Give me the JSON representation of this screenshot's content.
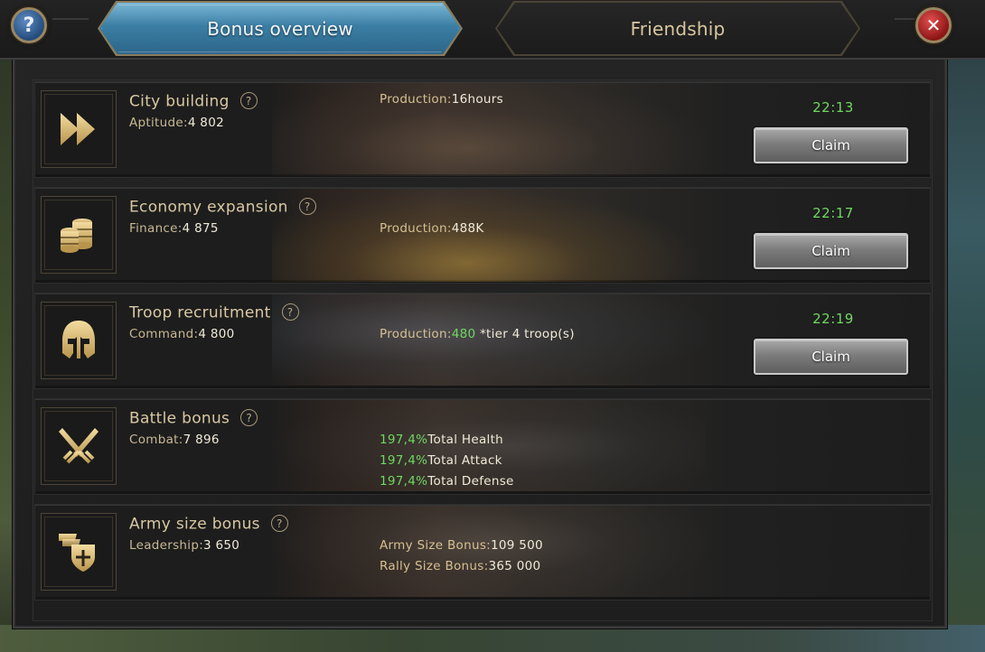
{
  "tabs": {
    "active": "Bonus overview",
    "inactive": "Friendship"
  },
  "buttons": {
    "help": "?",
    "close": "✕",
    "claim": "Claim"
  },
  "rows": [
    {
      "title": "City building",
      "stat_label": "Aptitude:",
      "stat_value": "4 802",
      "production_label": "Production:",
      "production_value": "16hours",
      "timer": "22:13",
      "icon": "fast-forward-icon"
    },
    {
      "title": "Economy expansion",
      "stat_label": "Finance:",
      "stat_value": "4 875",
      "production_label": "Production:",
      "production_value": "488K",
      "timer": "22:17",
      "icon": "coin-stack-icon"
    },
    {
      "title": "Troop recruitment",
      "stat_label": "Command:",
      "stat_value": "4 800",
      "production_label": "Production:",
      "production_value": "480",
      "production_suffix": " *tier 4 troop(s)",
      "timer": "22:19",
      "icon": "helmet-icon"
    },
    {
      "title": "Battle bonus",
      "stat_label": "Combat:",
      "stat_value": "7 896",
      "bonuses": [
        {
          "value": "197,4%",
          "label": "Total Health"
        },
        {
          "value": "197,4%",
          "label": "Total Attack"
        },
        {
          "value": "197,4%",
          "label": "Total Defense"
        }
      ],
      "icon": "crossed-swords-icon"
    },
    {
      "title": "Army size bonus",
      "stat_label": "Leadership:",
      "stat_value": "3 650",
      "army_size_label": "Army Size Bonus:",
      "army_size_value": "109 500",
      "rally_size_label": "Rally Size Bonus:",
      "rally_size_value": "365 000",
      "icon": "shield-flags-icon"
    }
  ],
  "colors": {
    "accent_tab": "#3b7ea4",
    "timer_green": "#6fd860",
    "title_gold": "#d9c8a2"
  }
}
